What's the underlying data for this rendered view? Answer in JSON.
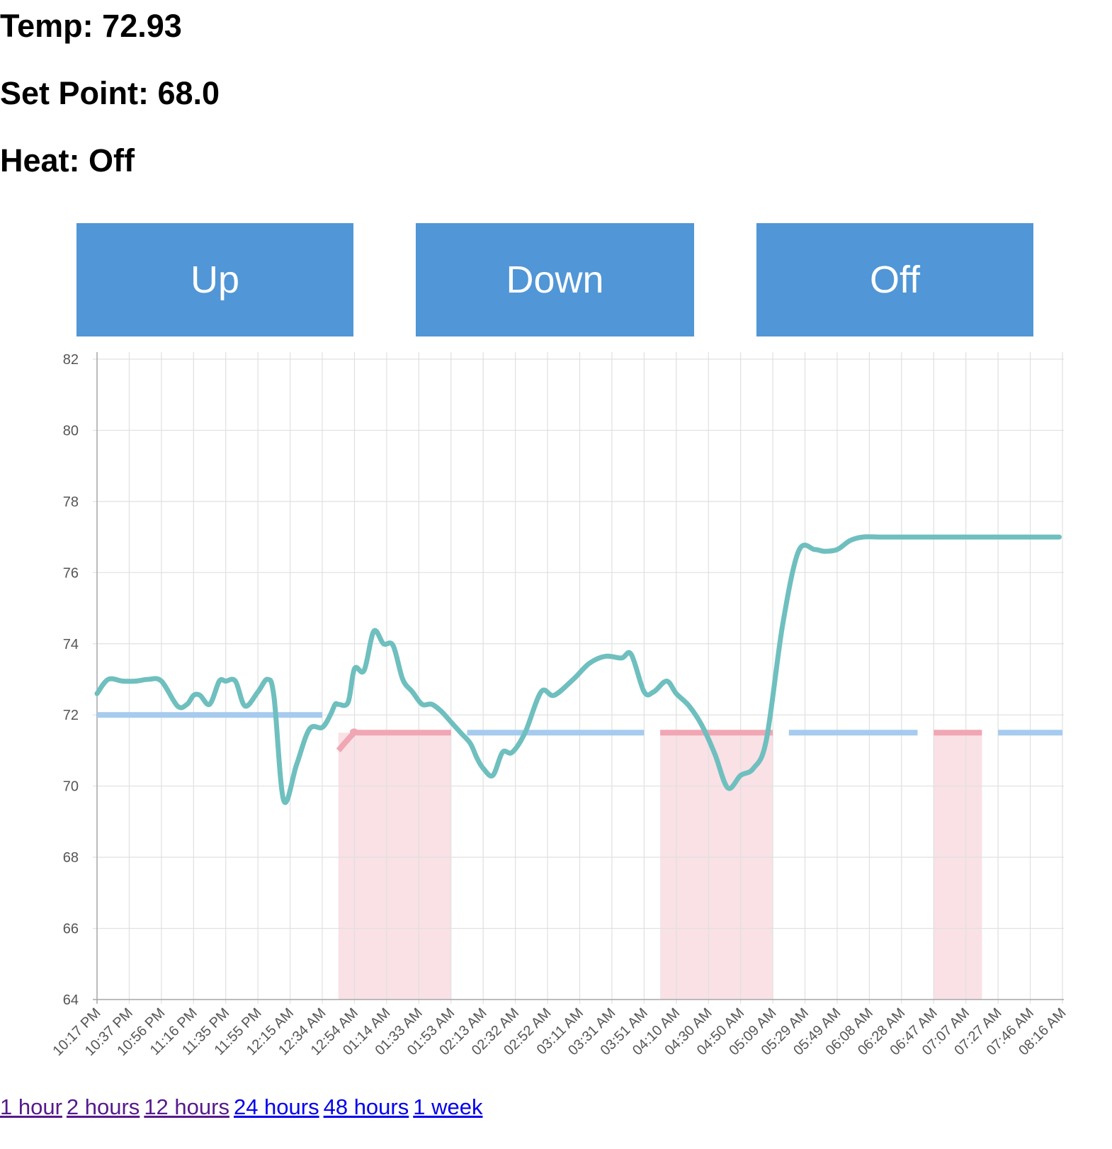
{
  "status": {
    "temp": "Temp: 72.93",
    "set_point": "Set Point: 68.0",
    "heat": "Heat: Off"
  },
  "buttons": {
    "up": "Up",
    "down": "Down",
    "off": "Off"
  },
  "range_links": [
    {
      "label": "1 hour",
      "visited": true
    },
    {
      "label": "2 hours",
      "visited": true
    },
    {
      "label": "12 hours",
      "visited": true
    },
    {
      "label": "24 hours",
      "visited": false
    },
    {
      "label": "48 hours",
      "visited": false
    },
    {
      "label": "1 week",
      "visited": false
    }
  ],
  "chart_data": {
    "type": "line",
    "title": "",
    "xlabel": "",
    "ylabel": "",
    "ylim": [
      64,
      82
    ],
    "yticks": [
      64,
      66,
      68,
      70,
      72,
      74,
      76,
      78,
      80,
      82
    ],
    "grid": true,
    "legend": "none",
    "categories": [
      "10:17 PM",
      "10:37 PM",
      "10:56 PM",
      "11:16 PM",
      "11:35 PM",
      "11:55 PM",
      "12:15 AM",
      "12:34 AM",
      "12:54 AM",
      "01:14 AM",
      "01:33 AM",
      "01:53 AM",
      "02:13 AM",
      "02:32 AM",
      "02:52 AM",
      "03:11 AM",
      "03:31 AM",
      "03:51 AM",
      "04:10 AM",
      "04:30 AM",
      "04:50 AM",
      "05:09 AM",
      "05:29 AM",
      "05:49 AM",
      "06:08 AM",
      "06:28 AM",
      "06:47 AM",
      "07:07 AM",
      "07:27 AM",
      "07:46 AM",
      "08:16 AM"
    ],
    "colors": {
      "temperature": "#6fbfbf",
      "setpoint_off": "#a6cbee",
      "setpoint_heating": "#f1a6b4",
      "heating_fill": "#f9e1e6"
    },
    "series": [
      {
        "role": "temperature",
        "x": [
          0,
          0.35,
          0.8,
          1.2,
          1.6,
          2.0,
          2.5,
          2.8,
          3.0,
          3.2,
          3.5,
          3.8,
          4.0,
          4.3,
          4.6,
          5.0,
          5.3,
          5.5,
          5.8,
          6.2,
          6.6,
          7.0,
          7.25,
          7.4,
          7.5,
          7.8,
          8.0,
          8.3,
          8.6,
          8.9,
          9.2,
          9.5,
          9.8,
          10.1,
          10.4,
          10.7,
          11.0,
          11.3,
          11.6,
          11.8,
          12.0,
          12.3,
          12.6,
          12.9,
          13.3,
          13.8,
          14.2,
          14.8,
          15.3,
          15.8,
          16.3,
          16.6,
          17.0,
          17.3,
          17.7,
          18.0,
          18.4,
          18.8,
          19.2,
          19.6,
          20.0,
          20.4,
          20.8,
          21.3,
          21.8,
          22.3,
          22.6,
          23.0,
          23.4,
          23.8,
          24.3,
          24.7,
          25.2,
          25.6,
          26.0,
          26.3,
          26.6,
          27.0,
          27.4,
          27.7,
          28.0,
          28.2,
          28.5,
          28.8,
          29.2,
          29.6,
          29.9,
          30.2
        ],
        "y": [
          72.6,
          73.0,
          72.95,
          72.95,
          73.0,
          72.95,
          72.25,
          72.3,
          72.55,
          72.55,
          72.3,
          72.95,
          72.95,
          72.95,
          72.25,
          72.65,
          73.0,
          72.5,
          69.6,
          70.6,
          71.6,
          71.65,
          72.0,
          72.3,
          72.3,
          72.35,
          73.3,
          73.25,
          74.35,
          74.0,
          73.95,
          73.0,
          72.65,
          72.3,
          72.3,
          72.1,
          71.8,
          71.5,
          71.2,
          70.8,
          70.5,
          70.3,
          70.95,
          70.95,
          71.5,
          72.65,
          72.55,
          73.0,
          73.45,
          73.65,
          73.6,
          73.7,
          72.65,
          72.65,
          72.95,
          72.6,
          72.25,
          71.7,
          70.9,
          69.95,
          70.3,
          70.5,
          71.3,
          74.5,
          76.6,
          76.65,
          76.6,
          76.65,
          76.9,
          77.0,
          77.0,
          77.0,
          77.0,
          77.0,
          77.0,
          77.0,
          77.0,
          77.0,
          77.0,
          77.0,
          77.0,
          77.0,
          77.0,
          77.0,
          77.0,
          77.0,
          77.0,
          77.0
        ]
      },
      {
        "role": "setpoint",
        "segments": [
          {
            "x": [
              0,
              7.0
            ],
            "y": [
              72.0,
              72.0
            ],
            "heating": false
          },
          {
            "x": [
              7.5,
              8.0,
              8.2,
              11.0
            ],
            "y": [
              71.0,
              71.5,
              71.5,
              71.5
            ],
            "heating": true
          },
          {
            "x": [
              11.5,
              17.0
            ],
            "y": [
              71.5,
              71.5
            ],
            "heating": false
          },
          {
            "x": [
              17.5,
              21.0
            ],
            "y": [
              71.5,
              71.5
            ],
            "heating": true
          },
          {
            "x": [
              21.5,
              25.5
            ],
            "y": [
              71.5,
              71.5
            ],
            "heating": false
          },
          {
            "x": [
              26.0,
              27.5
            ],
            "y": [
              71.5,
              71.5
            ],
            "heating": true
          },
          {
            "x": [
              28.0,
              30.0
            ],
            "y": [
              71.5,
              71.5
            ],
            "heating": false
          }
        ]
      }
    ],
    "heating_periods": [
      [
        7.5,
        11.0
      ],
      [
        17.5,
        21.0
      ],
      [
        26.0,
        27.5
      ]
    ]
  }
}
